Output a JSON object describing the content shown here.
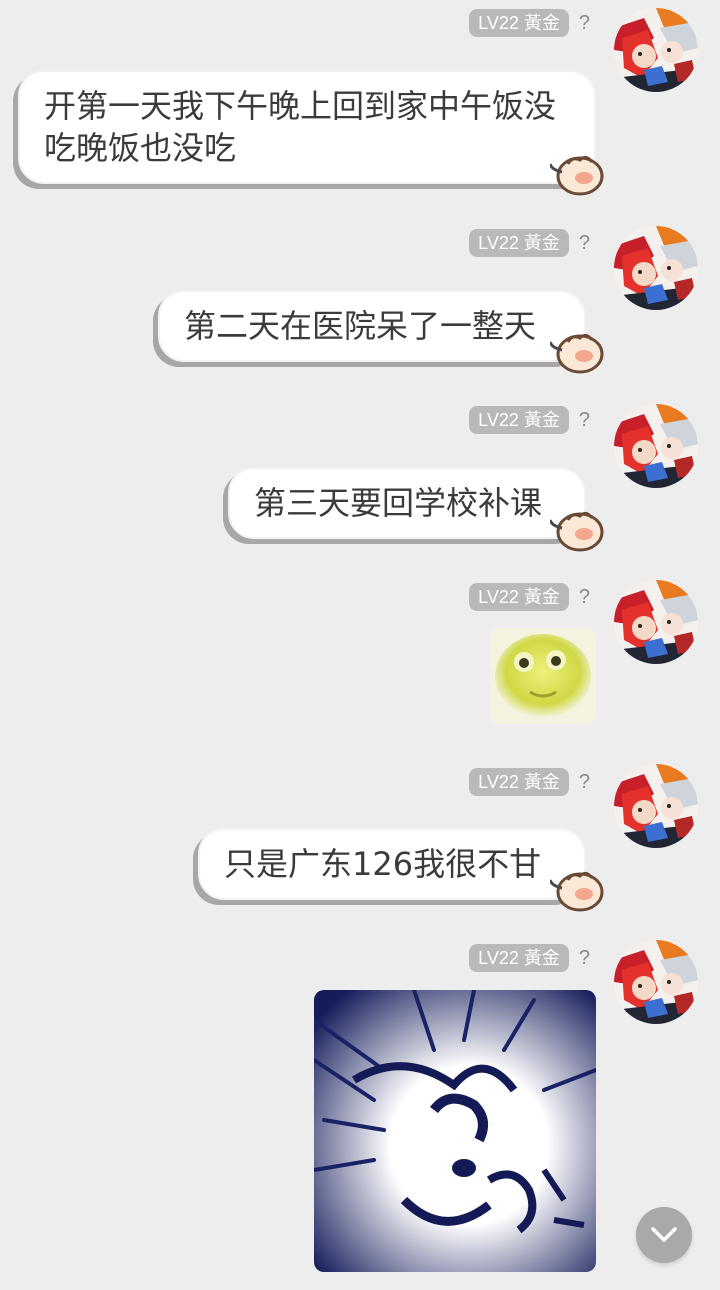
{
  "user": {
    "level_badge": "LV22 黃金",
    "unknown_mark": "?"
  },
  "messages": [
    {
      "type": "text",
      "text": "开第一天我下午晚上回到家中午饭没吃晚饭也没吃"
    },
    {
      "type": "text",
      "text": "第二天在医院呆了一整天"
    },
    {
      "type": "text",
      "text": "第三天要回学校补课"
    },
    {
      "type": "sticker",
      "sticker": "yellow-frog-face-sticker"
    },
    {
      "type": "text",
      "text": "只是广东126我很不甘"
    },
    {
      "type": "sticker",
      "sticker": "angry-cat-sketch-sticker"
    }
  ],
  "controls": {
    "scroll_down_icon": "chevron-down-icon"
  }
}
